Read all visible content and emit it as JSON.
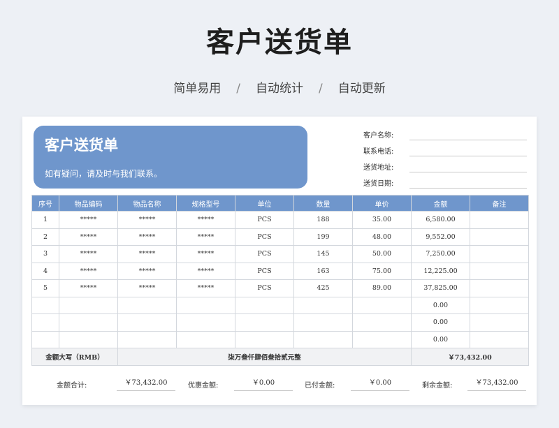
{
  "page": {
    "title": "客户送货单",
    "subtitle": {
      "item1": "简单易用",
      "sep1": "/",
      "item2": "自动统计",
      "sep2": "/",
      "item3": "自动更新"
    }
  },
  "card": {
    "banner": {
      "title": "客户送货单",
      "note": "如有疑问，请及时与我们联系。"
    },
    "info_labels": [
      "客户名称:",
      "联系电话:",
      "送货地址:",
      "送货日期:"
    ],
    "columns": [
      "序号",
      "物品编码",
      "物品名称",
      "规格型号",
      "单位",
      "数量",
      "单价",
      "金额",
      "备注"
    ],
    "rows": [
      [
        "1",
        "*****",
        "*****",
        "*****",
        "PCS",
        "188",
        "35.00",
        "6,580.00",
        ""
      ],
      [
        "2",
        "*****",
        "*****",
        "*****",
        "PCS",
        "199",
        "48.00",
        "9,552.00",
        ""
      ],
      [
        "3",
        "*****",
        "*****",
        "*****",
        "PCS",
        "145",
        "50.00",
        "7,250.00",
        ""
      ],
      [
        "4",
        "*****",
        "*****",
        "*****",
        "PCS",
        "163",
        "75.00",
        "12,225.00",
        ""
      ],
      [
        "5",
        "*****",
        "*****",
        "*****",
        "PCS",
        "425",
        "89.00",
        "37,825.00",
        ""
      ],
      [
        "",
        "",
        "",
        "",
        "",
        "",
        "",
        "0.00",
        ""
      ],
      [
        "",
        "",
        "",
        "",
        "",
        "",
        "",
        "0.00",
        ""
      ],
      [
        "",
        "",
        "",
        "",
        "",
        "",
        "",
        "0.00",
        ""
      ]
    ],
    "total": {
      "label": "金额大写（RMB）",
      "words": "柒万叁仟肆佰叁拾贰元整",
      "amount": "￥73,432.00"
    },
    "summary": {
      "total_label": "金额合计:",
      "total_value": "￥73,432.00",
      "discount_label": "优惠金额:",
      "discount_value": "￥0.00",
      "paid_label": "已付金额:",
      "paid_value": "￥0.00",
      "remain_label": "剩余金额:",
      "remain_value": "￥73,432.00"
    }
  }
}
